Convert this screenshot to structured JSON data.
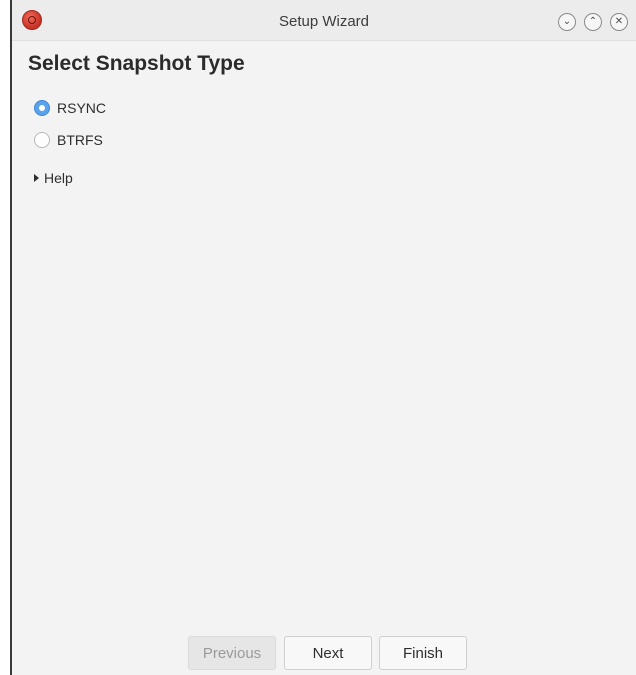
{
  "window": {
    "title": "Setup Wizard",
    "controls": {
      "minimize": "⌄",
      "maximize": "⌃",
      "close": "✕"
    }
  },
  "page": {
    "heading": "Select Snapshot Type"
  },
  "snapshot_type": {
    "options": [
      {
        "label": "RSYNC",
        "selected": true
      },
      {
        "label": "BTRFS",
        "selected": false
      }
    ]
  },
  "help": {
    "label": "Help",
    "expanded": false
  },
  "buttons": {
    "previous": {
      "label": "Previous",
      "enabled": false
    },
    "next": {
      "label": "Next",
      "enabled": true
    },
    "finish": {
      "label": "Finish",
      "enabled": true
    }
  },
  "colors": {
    "accent": "#5aa2ea",
    "app_icon": "#d8392c"
  }
}
